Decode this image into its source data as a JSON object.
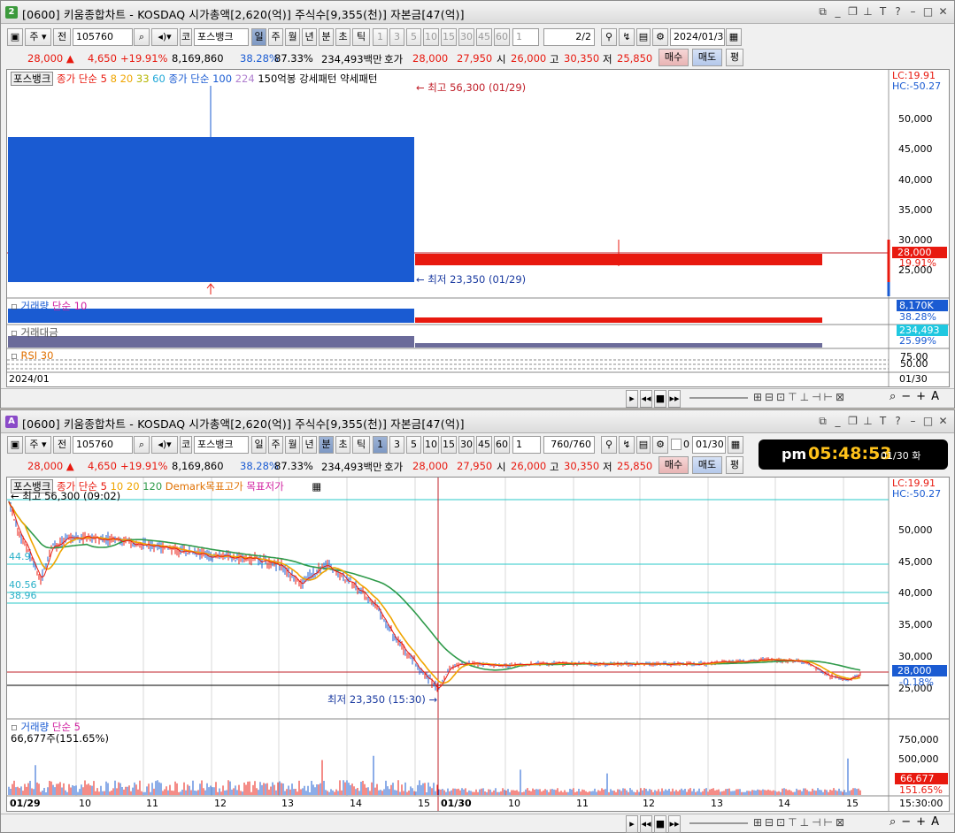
{
  "win1": {
    "badge": "2",
    "title": "[0600] 키움종합차트 - KOSDAQ 시가총액[2,620(억)] 주식수[9,355(천)] 자본금[47(억)]",
    "toolbar": {
      "mode_a": "주",
      "mode_b": "전",
      "code": "105760",
      "sort_label": "코",
      "stock_name": "포스뱅크",
      "periods": [
        "일",
        "주",
        "월",
        "년",
        "분",
        "초",
        "틱"
      ],
      "numbers": [
        "1",
        "3",
        "5",
        "10",
        "15",
        "30",
        "45",
        "60"
      ],
      "custom_num": "1",
      "page": "2/2",
      "date": "2024/01/30"
    },
    "quote": {
      "price": "28,000 ▲",
      "change": "4,650",
      "change_pct": "+19.91%",
      "volume": "8,169,860",
      "turnover": "38.28%",
      "ratio": "87.33%",
      "amount": "234,493백만",
      "ask_label": "호가",
      "ask": "28,000",
      "bid": "27,950",
      "open_label": "시",
      "open": "26,000",
      "high_label": "고",
      "high": "30,350",
      "low_label": "저",
      "low": "25,850",
      "buy": "매수",
      "sell": "매도",
      "eval": "평"
    },
    "legend": {
      "name": "포스뱅크",
      "ma_label": "종가 단순 5",
      "ma8": "8",
      "ma20": "20",
      "ma33": "33",
      "ma60": "60",
      "ma_label2": "종가 단순 100",
      "ma224": "224",
      "pattern": "150억봉 강세패턴",
      "pattern2": "약세패턴"
    },
    "annot": {
      "high": "최고 56,300 (01/29)",
      "low": "최저 23,350 (01/29)"
    },
    "yaxis": [
      "50,000",
      "45,000",
      "40,000",
      "35,000",
      "30,000",
      "25,000"
    ],
    "lc": "LC:19.91",
    "hc": "HC:-50.27",
    "price_tag": "28,000",
    "pct_tag": "19.91%",
    "vol": {
      "label": "거래량",
      "label2": "단순 10",
      "tag": "8,170K",
      "pct": "38.28%"
    },
    "amt": {
      "label": "거래대금",
      "tag": "234,493",
      "pct": "25.99%"
    },
    "rsi": {
      "label": "RSI 30",
      "y1": "75.00",
      "y2": "50.00"
    },
    "xaxis": {
      "left": "2024/01",
      "right": "01/30"
    }
  },
  "win2": {
    "badge": "A",
    "title": "[0600] 키움종합차트 - KOSDAQ 시가총액[2,620(억)] 주식수[9,355(천)] 자본금[47(억)]",
    "toolbar": {
      "mode_a": "주",
      "mode_b": "전",
      "code": "105760",
      "sort_label": "코",
      "stock_name": "포스뱅크",
      "periods": [
        "일",
        "주",
        "월",
        "년",
        "분",
        "초",
        "틱"
      ],
      "numbers": [
        "1",
        "3",
        "5",
        "10",
        "15",
        "30",
        "45",
        "60"
      ],
      "custom_num": "1",
      "page": "760/760",
      "check_label": "0",
      "date": "01/30"
    },
    "clock": {
      "ampm": "pm",
      "time": "05:48:53",
      "date": "01/30 화"
    },
    "legend": {
      "name": "포스뱅크",
      "ma_label": "종가 단순 5",
      "ma10": "10",
      "ma20": "20",
      "ma120": "120",
      "demark_high": "Demark목표고가",
      "demark_low": "목표저가"
    },
    "annot": {
      "high": "최고 56,300 (09:02)",
      "low": "최저 23,350 (15:30)"
    },
    "levels": {
      "l1": "44.9",
      "l2": "40.56",
      "l3": "38.96"
    },
    "yaxis": [
      "50,000",
      "45,000",
      "40,000",
      "35,000",
      "30,000",
      "25,000"
    ],
    "lc": "LC:19.91",
    "hc": "HC:-50.27",
    "price_tag": "28,000",
    "pct_tag": "-0.18%",
    "vol": {
      "label": "거래량",
      "label2": "단순 5",
      "value": "66,677주(151.65%)",
      "y1": "750,000",
      "y2": "500,000",
      "tag": "66,677",
      "pct": "151.65%"
    },
    "xaxis": [
      "01/29",
      "10",
      "11",
      "12",
      "13",
      "14",
      "15",
      "01/30",
      "10",
      "11",
      "12",
      "13",
      "14",
      "15"
    ],
    "time_end": "15:30:00"
  },
  "colors": {
    "up": "#e8190f",
    "down": "#1a5bd2",
    "amt": "#6b6b9a",
    "ma5": "#e8190f",
    "ma10": "#f0a500",
    "ma120": "#2f9a4a"
  },
  "icons": [
    "calendar-icon",
    "search-icon",
    "gear-icon",
    "save-icon",
    "play-icon",
    "pause-icon",
    "stop-icon",
    "zoom-icon"
  ]
}
